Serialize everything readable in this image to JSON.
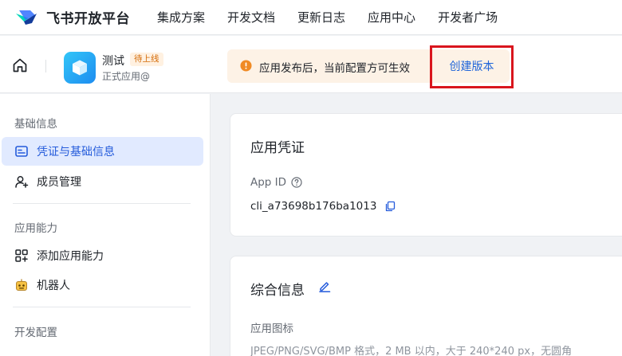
{
  "brand": {
    "name": "飞书开放平台",
    "logo_icon": "feishu-logo-icon"
  },
  "topnav": {
    "items": [
      {
        "label": "集成方案"
      },
      {
        "label": "开发文档"
      },
      {
        "label": "更新日志"
      },
      {
        "label": "应用中心"
      },
      {
        "label": "开发者广场"
      }
    ]
  },
  "appbar": {
    "home_icon": "home-icon",
    "app_name": "测试",
    "status_badge": "待上线",
    "app_subtitle": "正式应用@",
    "notice_text": "应用发布后，当前配置方可生效",
    "create_version_label": "创建版本",
    "colors": {
      "notice_bg": "#fdf2e6",
      "warning": "#f08a24",
      "link": "#1e64d9",
      "highlight_border": "#d9151d"
    }
  },
  "sidebar": {
    "groups": [
      {
        "title": "基础信息",
        "items": [
          {
            "label": "凭证与基础信息",
            "icon": "id-card-icon",
            "active": true
          },
          {
            "label": "成员管理",
            "icon": "user-add-icon",
            "active": false
          }
        ]
      },
      {
        "title": "应用能力",
        "items": [
          {
            "label": "添加应用能力",
            "icon": "grid-add-icon",
            "active": false
          },
          {
            "label": "机器人",
            "icon": "robot-icon",
            "active": false
          }
        ]
      },
      {
        "title": "开发配置",
        "items": []
      }
    ]
  },
  "main": {
    "credentials": {
      "title": "应用凭证",
      "app_id_label": "App ID",
      "app_id_value": "cli_a73698b176ba1013"
    },
    "general_info": {
      "title": "综合信息",
      "app_icon_label": "应用图标",
      "app_icon_hint": "JPEG/PNG/SVG/BMP 格式，2 MB 以内，大于 240*240 px，无圆角"
    }
  }
}
